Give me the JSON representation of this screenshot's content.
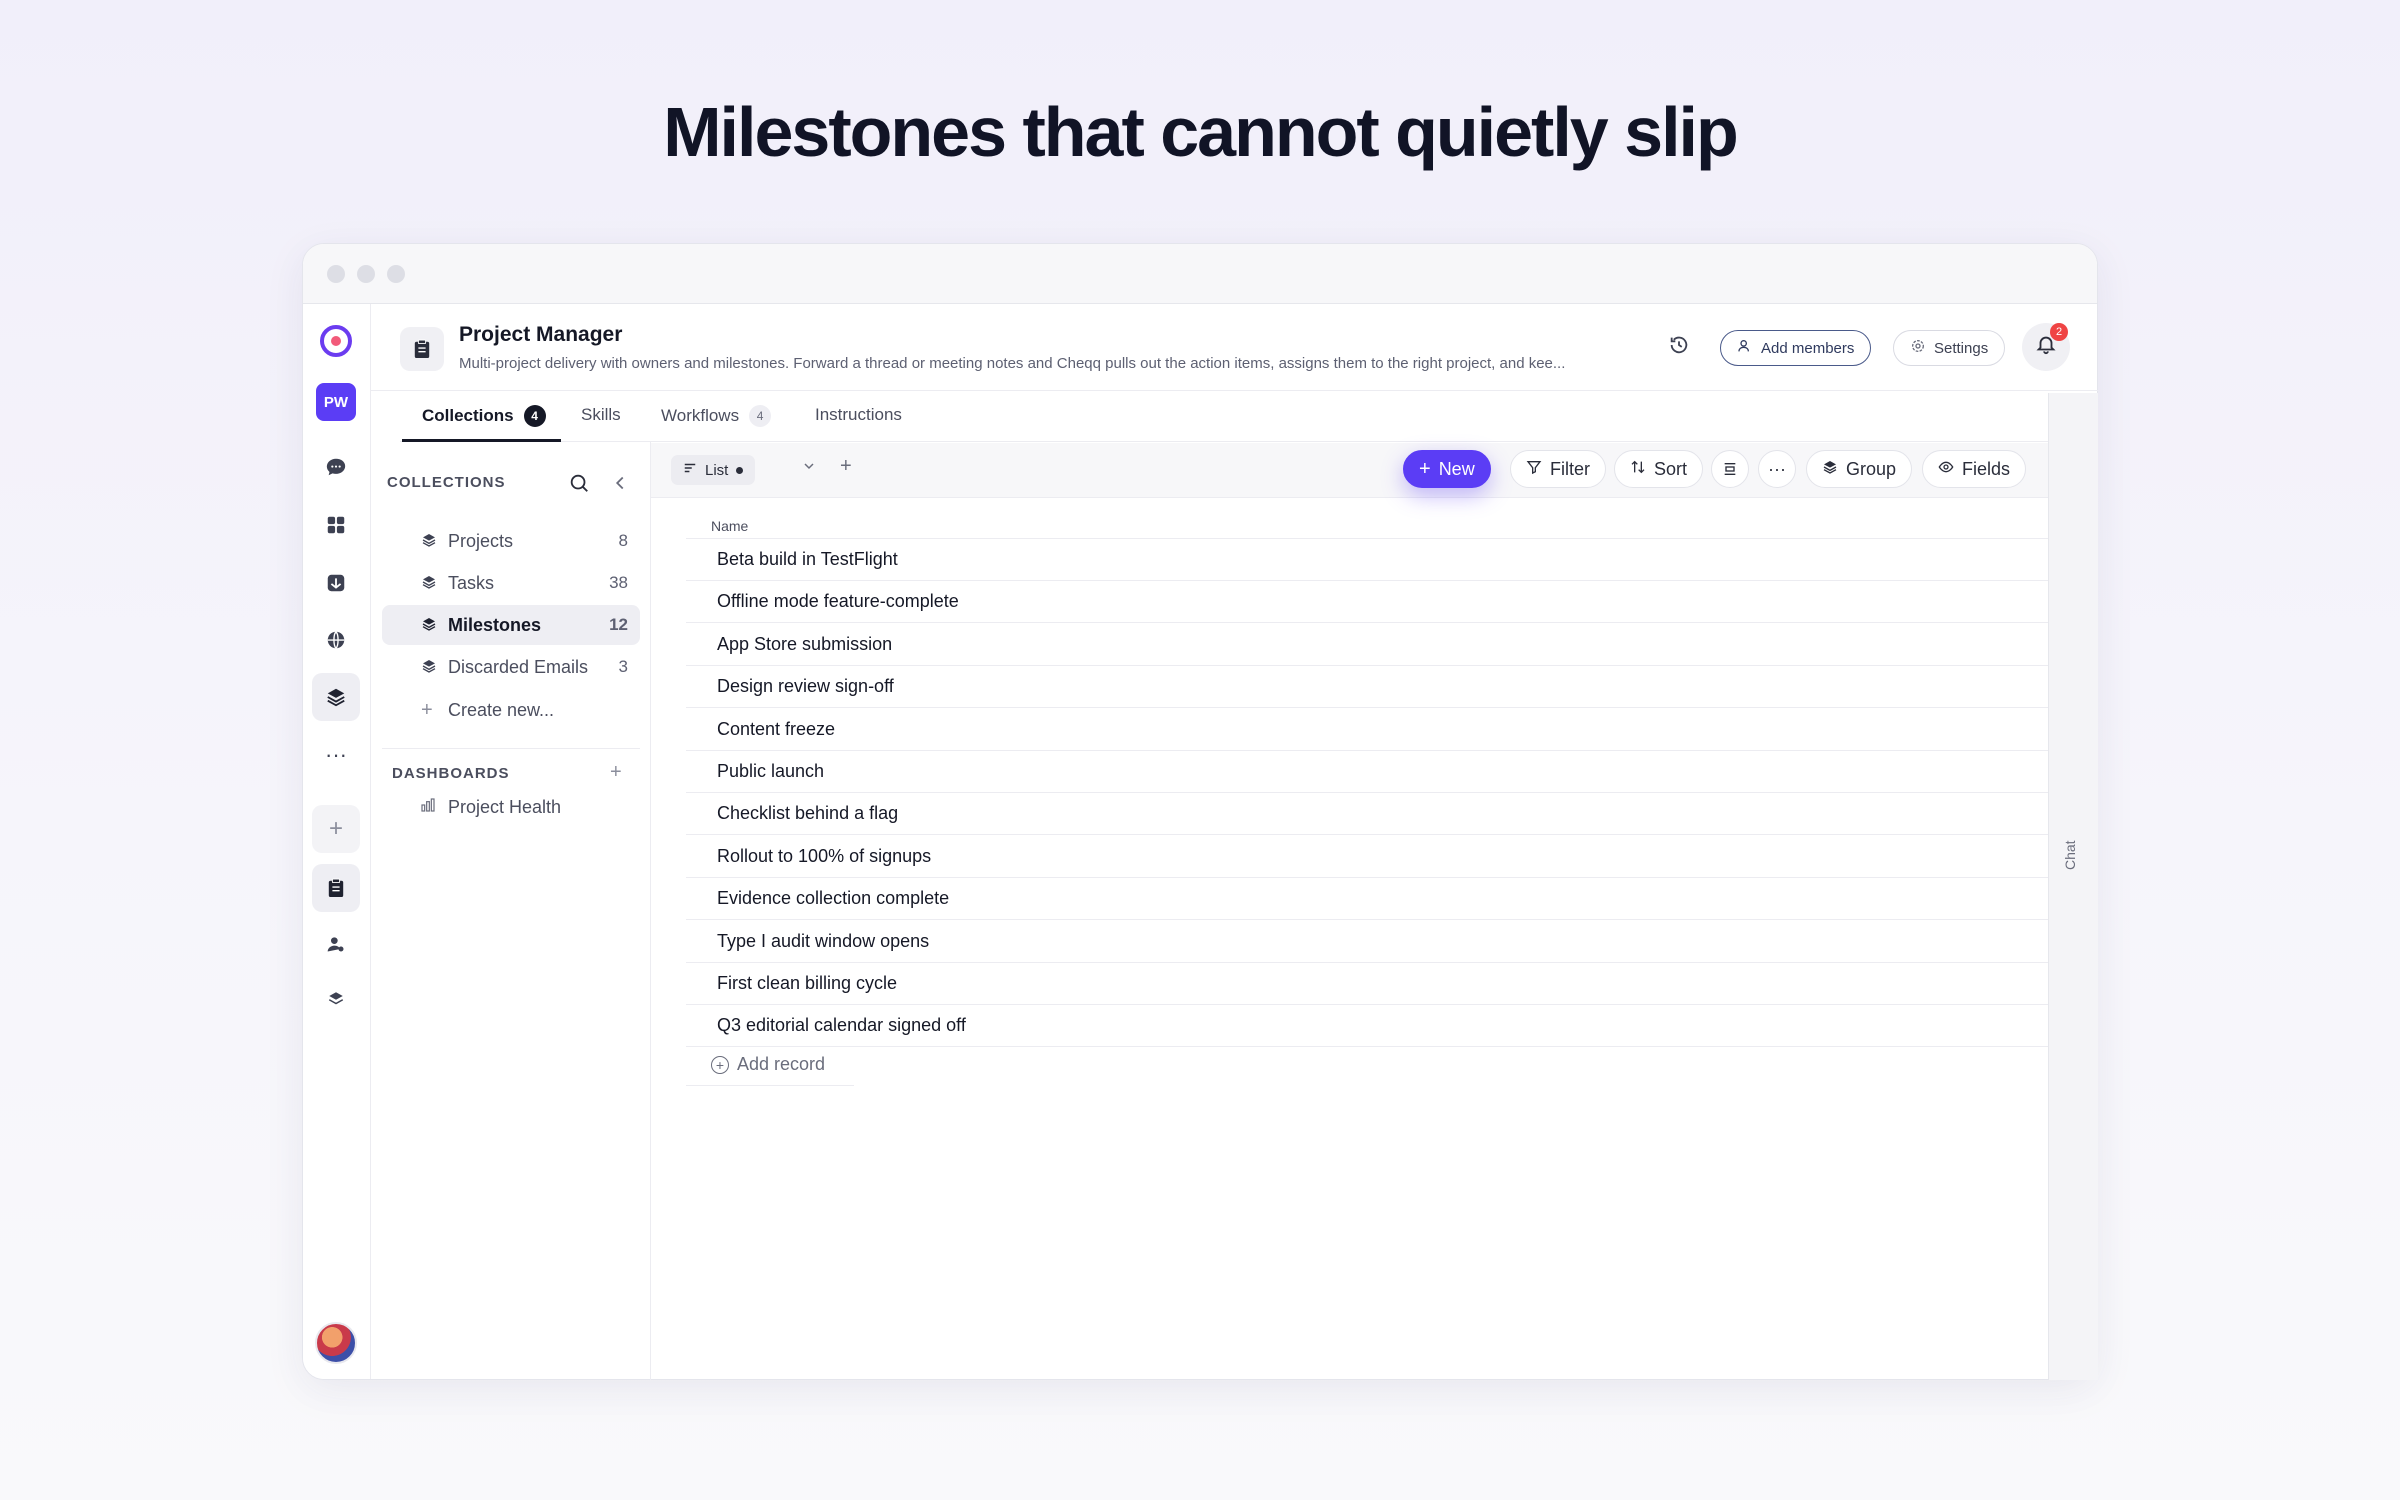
{
  "headline": "Milestones that cannot quietly slip",
  "header": {
    "title": "Project Manager",
    "description": "Multi-project delivery with owners and milestones. Forward a thread or meeting notes and Cheqq pulls out the action items, assigns them to the right project, and kee...",
    "add_members": "Add members",
    "settings": "Settings",
    "notifications": "2"
  },
  "rail": {
    "workspace": "PW"
  },
  "tabs": [
    {
      "label": "Collections",
      "count": "4"
    },
    {
      "label": "Skills"
    },
    {
      "label": "Workflows",
      "count": "4"
    },
    {
      "label": "Instructions"
    }
  ],
  "sidebar": {
    "collections_label": "COLLECTIONS",
    "items": [
      {
        "label": "Projects",
        "count": "8"
      },
      {
        "label": "Tasks",
        "count": "38"
      },
      {
        "label": "Milestones",
        "count": "12"
      },
      {
        "label": "Discarded Emails",
        "count": "3"
      }
    ],
    "create_new": "Create new...",
    "dashboards_label": "DASHBOARDS",
    "dashboards": [
      {
        "label": "Project Health"
      }
    ]
  },
  "toolbar": {
    "view": "List",
    "new": "New",
    "filter": "Filter",
    "sort": "Sort",
    "group": "Group",
    "fields": "Fields"
  },
  "table": {
    "column": "Name",
    "rows": [
      "Beta build in TestFlight",
      "Offline mode feature-complete",
      "App Store submission",
      "Design review sign-off",
      "Content freeze",
      "Public launch",
      "Checklist behind a flag",
      "Rollout to 100% of signups",
      "Evidence collection complete",
      "Type I audit window opens",
      "First clean billing cycle",
      "Q3 editorial calendar signed off"
    ],
    "add_record": "Add record"
  },
  "chat_label": "Chat",
  "colors": {
    "accent": "#5b3df5",
    "badge": "#ef4444"
  }
}
